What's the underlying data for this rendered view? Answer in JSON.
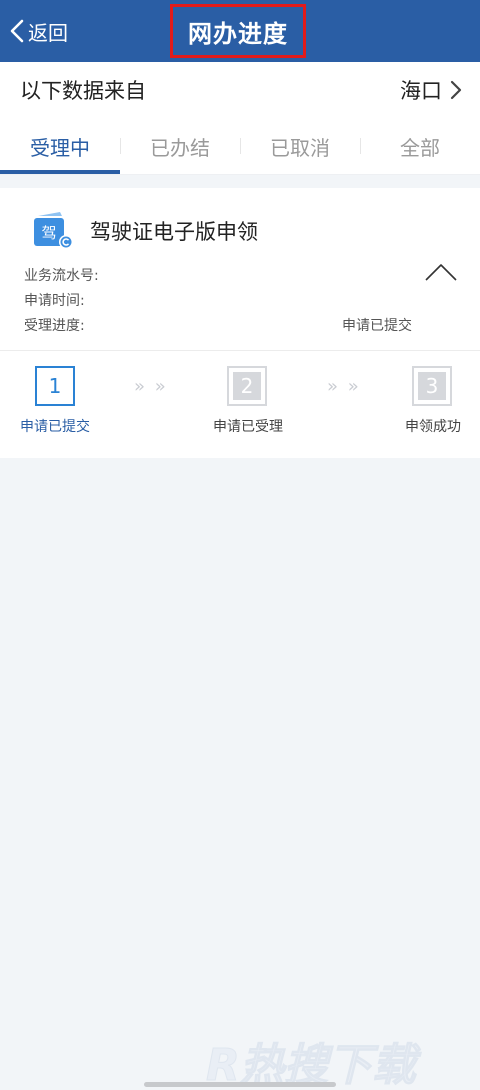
{
  "header": {
    "back_label": "返回",
    "title": "网办进度"
  },
  "source": {
    "label": "以下数据来自",
    "city": "海口"
  },
  "tabs": [
    {
      "label": "受理中"
    },
    {
      "label": "已办结"
    },
    {
      "label": "已取消"
    },
    {
      "label": "全部"
    }
  ],
  "item": {
    "icon_char": "驾",
    "title": "驾驶证电子版申领",
    "serial_label": "业务流水号:",
    "time_label": "申请时间:",
    "progress_label": "受理进度:",
    "progress_value": "申请已提交"
  },
  "steps": [
    {
      "num": "1",
      "label": "申请已提交",
      "state": "active"
    },
    {
      "num": "2",
      "label": "申请已受理",
      "state": "inactive"
    },
    {
      "num": "3",
      "label": "申领成功",
      "state": "inactive"
    }
  ],
  "step_separator": "» »",
  "watermark": "R热搜下载",
  "colors": {
    "header_bg": "#2a5ea5",
    "accent": "#2a5ea5",
    "highlight_border": "#e21b1b"
  }
}
